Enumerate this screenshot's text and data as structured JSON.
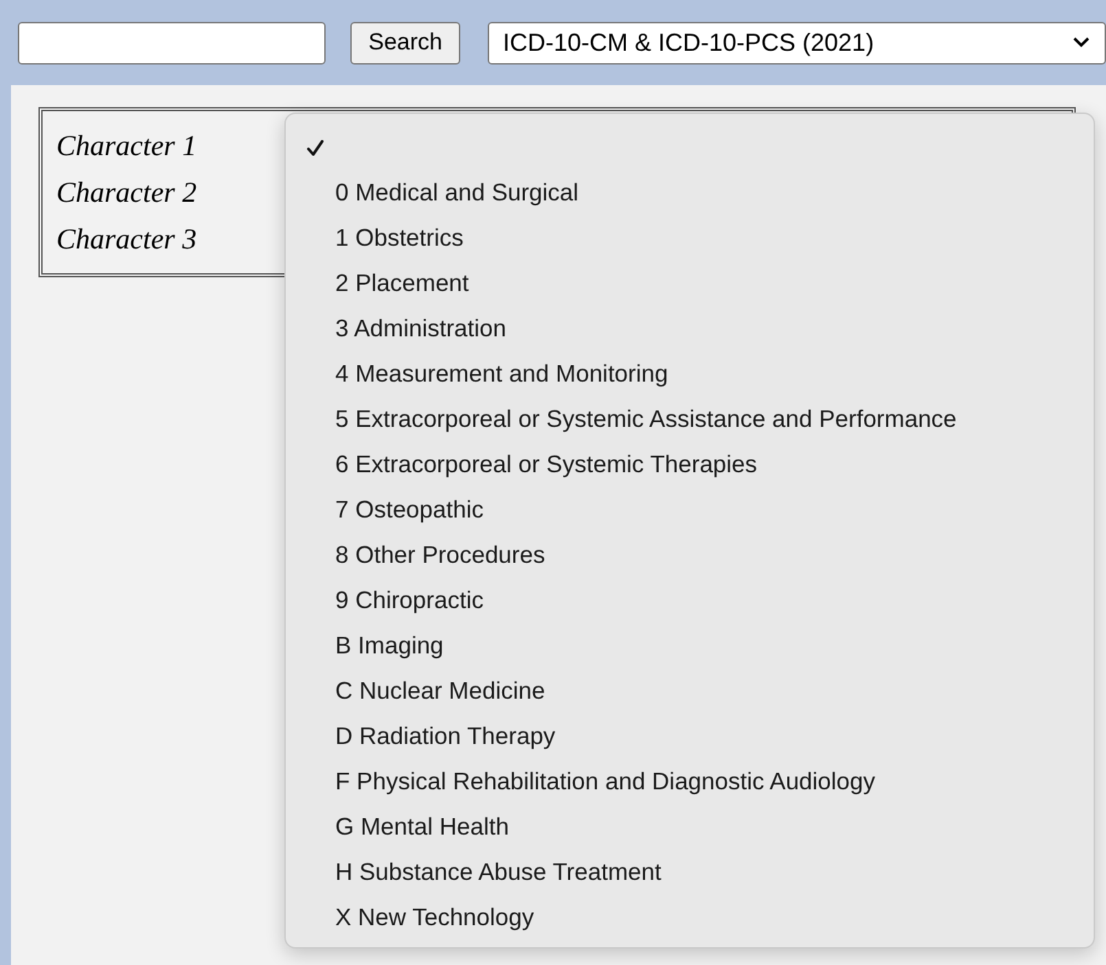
{
  "search": {
    "button": "Search"
  },
  "code_set": {
    "value": "ICD-10-CM & ICD-10-PCS (2021)"
  },
  "characters": [
    "Character 1",
    "Character 2",
    "Character 3"
  ],
  "menu": {
    "items": [
      {
        "selected": true
      },
      {
        "label": "0 Medical and Surgical",
        "selected": false
      },
      {
        "label": "1 Obstetrics",
        "selected": false
      },
      {
        "label": "2 Placement",
        "selected": false
      },
      {
        "label": "3 Administration",
        "selected": false
      },
      {
        "label": "4 Measurement and Monitoring",
        "selected": false
      },
      {
        "label": "5 Extracorporeal or Systemic Assistance and Performance",
        "selected": false
      },
      {
        "label": "6 Extracorporeal or Systemic Therapies",
        "selected": false
      },
      {
        "label": "7 Osteopathic",
        "selected": false
      },
      {
        "label": "8 Other Procedures",
        "selected": false
      },
      {
        "label": "9 Chiropractic",
        "selected": false
      },
      {
        "label": "B Imaging",
        "selected": false
      },
      {
        "label": "C Nuclear Medicine",
        "selected": false
      },
      {
        "label": "D Radiation Therapy",
        "selected": false
      },
      {
        "label": "F Physical Rehabilitation and Diagnostic Audiology",
        "selected": false
      },
      {
        "label": "G Mental Health",
        "selected": false
      },
      {
        "label": "H Substance Abuse Treatment",
        "selected": false
      },
      {
        "label": "X New Technology",
        "selected": false
      }
    ]
  }
}
